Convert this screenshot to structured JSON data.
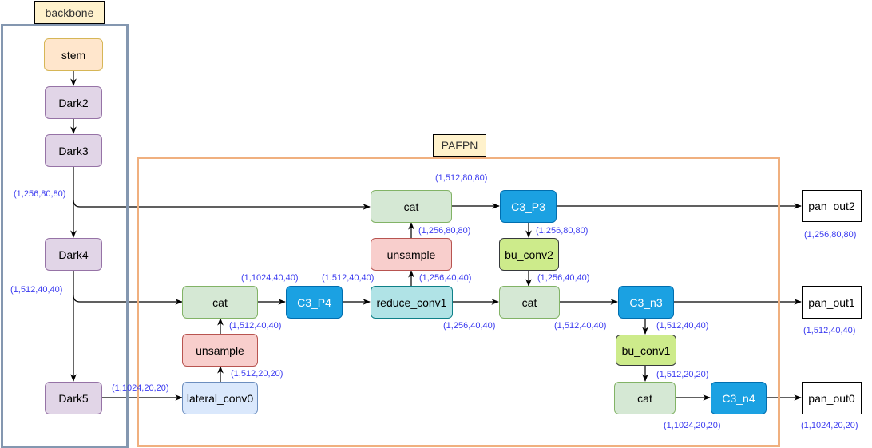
{
  "groups": {
    "backbone": "backbone",
    "pafpn": "PAFPN"
  },
  "nodes": {
    "stem": "stem",
    "dark2": "Dark2",
    "dark3": "Dark3",
    "dark4": "Dark4",
    "dark5": "Dark5",
    "lateral_conv0": "lateral_conv0",
    "unsample_p4": "unsample",
    "cat_p4": "cat",
    "c3_p4": "C3_P4",
    "reduce_conv1": "reduce_conv1",
    "unsample_p3": "unsample",
    "cat_p3": "cat",
    "c3_p3": "C3_P3",
    "bu_conv2": "bu_conv2",
    "cat_n3": "cat",
    "c3_n3": "C3_n3",
    "bu_conv1": "bu_conv1",
    "cat_n4": "cat",
    "c3_n4": "C3_n4",
    "pan_out2": "pan_out2",
    "pan_out1": "pan_out1",
    "pan_out0": "pan_out0"
  },
  "shapes": {
    "dark3_out": "(1,256,80,80)",
    "dark4_out": "(1,512,40,40)",
    "dark5_out": "(1,1024,20,20)",
    "lateral_out": "(1,512,20,20)",
    "unsample_p4_out": "(1,512,40,40)",
    "cat_p4_out": "(1,1024,40,40)",
    "c3_p4_out": "(1,512,40,40)",
    "reduce_conv1_up": "(1,256,40,40)",
    "reduce_conv1_right": "(1,256,40,40)",
    "unsample_p3_out": "(1,256,80,80)",
    "cat_p3_out": "(1,512,80,80)",
    "c3_p3_down": "(1,256,80,80)",
    "bu_conv2_out": "(1,256,40,40)",
    "cat_n3_out": "(1,512,40,40)",
    "c3_n3_down": "(1,512,40,40)",
    "bu_conv1_out": "(1,512,20,20)",
    "cat_n4_out": "(1,1024,20,20)",
    "pan_out2": "(1,256,80,80)",
    "pan_out1": "(1,512,40,40)",
    "pan_out0": "(1,1024,20,20)"
  },
  "colors": {
    "backbone_frame": "#8497b0",
    "pafpn_frame": "#f0b07f",
    "shape_text": "#3c3cf0"
  }
}
